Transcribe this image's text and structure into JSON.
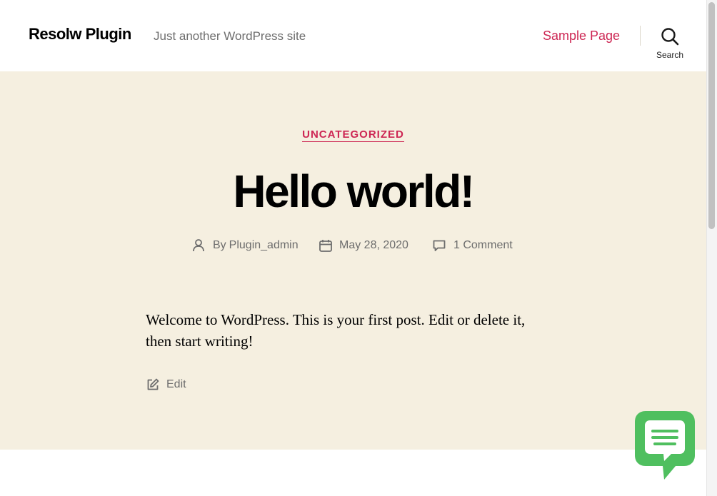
{
  "header": {
    "site_title": "Resolw Plugin",
    "site_description": "Just another WordPress site",
    "nav_items": [
      {
        "label": "Sample Page"
      }
    ],
    "search_label": "Search"
  },
  "post": {
    "category": "UNCATEGORIZED",
    "title": "Hello world!",
    "author_prefix": "By",
    "author": "Plugin_admin",
    "date": "May 28, 2020",
    "comments": "1 Comment",
    "content_line_1": "Welcome to WordPress. This is your first post. Edit or delete it,",
    "content_line_2": "then start writing!",
    "edit_label": "Edit"
  },
  "colors": {
    "accent": "#cd2653",
    "hero_background": "#f5efe0",
    "meta_text": "#6d6d6d",
    "chat_widget": "#4fbf5f"
  },
  "icons": {
    "search": "search-icon",
    "author": "user-icon",
    "date": "calendar-icon",
    "comments": "comment-icon",
    "edit": "edit-icon",
    "chat": "chat-bubble-icon"
  }
}
